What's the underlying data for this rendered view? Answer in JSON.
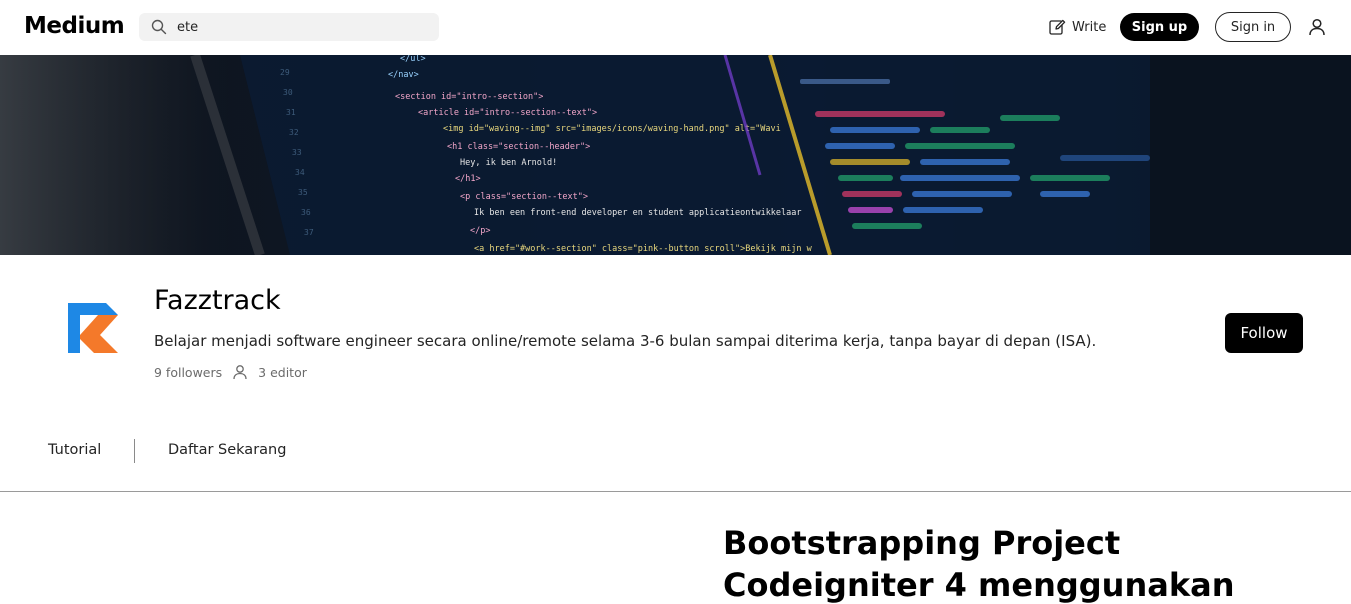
{
  "header": {
    "logo": "Medium",
    "search": {
      "value": "ete",
      "placeholder": "Search"
    },
    "write_label": "Write",
    "signup_label": "Sign up",
    "signin_label": "Sign in"
  },
  "banner": {
    "code_lines": [
      "</ul>",
      "</nav>",
      "<section id=\"intro--section\">",
      "<article id=\"intro--section--text\">",
      "<img id=\"waving--img\" src=\"images/icons/waving-hand.png\" alt=\"Wavi",
      "<h1 class=\"section--header\">",
      "Hey, ik ben Arnold!",
      "</h1>",
      "<p class=\"section--text\">",
      "Ik ben een front-end developer en student applicatieontwikkelaar",
      "</p>",
      "<a href=\"#work--section\" class=\"pink--button scroll\">Bekijk mijn w"
    ]
  },
  "publication": {
    "name": "Fazztrack",
    "description": "Belajar menjadi software engineer secara online/remote selama 3-6 bulan sampai diterima kerja, tanpa bayar di depan (ISA).",
    "followers": "9 followers",
    "editors": "3 editor",
    "follow_label": "Follow"
  },
  "nav": {
    "items": [
      {
        "label": "Tutorial"
      },
      {
        "label": "Daftar Sekarang"
      }
    ]
  },
  "article": {
    "title_line1": "Bootstrapping Project",
    "title_line2": "Codeigniter 4 menggunakan"
  },
  "colors": {
    "primary": "#000000",
    "text": "#242424",
    "muted": "#6b6b6b",
    "search_bg": "#f2f2f2",
    "logo_blue": "#1e88e5",
    "logo_orange": "#f4792a"
  }
}
